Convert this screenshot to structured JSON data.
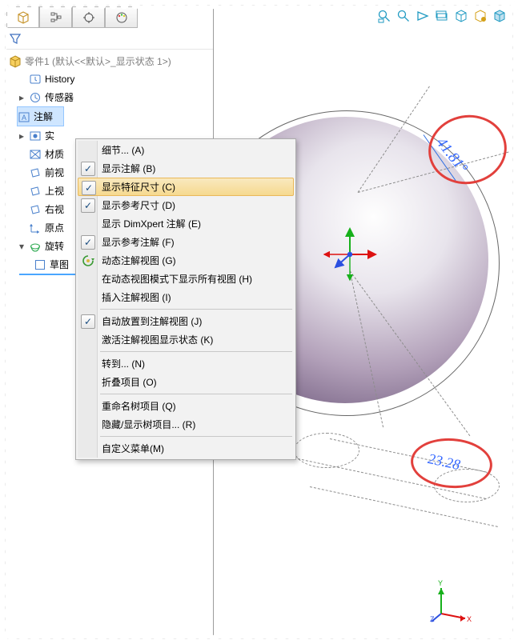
{
  "topIcons": [
    "cube",
    "tree",
    "target",
    "palette"
  ],
  "root": "零件1  (默认<<默认>_显示状态 1>)",
  "tree": [
    {
      "icon": "history",
      "label": "History",
      "expander": ""
    },
    {
      "icon": "sensor",
      "label": "传感器",
      "expander": "▸"
    },
    {
      "icon": "annot",
      "label": "注解",
      "expander": "▸",
      "selected": true
    },
    {
      "icon": "solid",
      "label": "实",
      "expander": "▸"
    },
    {
      "icon": "mat",
      "label": "材质",
      "expander": ""
    },
    {
      "icon": "plane",
      "label": "前视",
      "expander": ""
    },
    {
      "icon": "plane",
      "label": "上视",
      "expander": ""
    },
    {
      "icon": "plane",
      "label": "右视",
      "expander": ""
    },
    {
      "icon": "origin",
      "label": "原点",
      "expander": ""
    },
    {
      "icon": "rev",
      "label": "旋转",
      "expander": "▾"
    },
    {
      "icon": "sketch",
      "label": "草图",
      "expander": "",
      "sub": true
    }
  ],
  "menu": [
    {
      "type": "item",
      "label": "细节... (A)"
    },
    {
      "type": "item",
      "label": "显示注解 (B)",
      "check": true
    },
    {
      "type": "item",
      "label": "显示特征尺寸 (C)",
      "check": true,
      "hover": true
    },
    {
      "type": "item",
      "label": "显示参考尺寸 (D)",
      "check": true
    },
    {
      "type": "item",
      "label": "显示 DimXpert 注解 (E)"
    },
    {
      "type": "item",
      "label": "显示参考注解 (F)",
      "check": true
    },
    {
      "type": "item",
      "label": "动态注解视图 (G)",
      "glyph": "dyn"
    },
    {
      "type": "item",
      "label": "在动态视图模式下显示所有视图 (H)"
    },
    {
      "type": "item",
      "label": "插入注解视图 (I)"
    },
    {
      "type": "sep"
    },
    {
      "type": "item",
      "label": "自动放置到注解视图 (J)",
      "check": true
    },
    {
      "type": "item",
      "label": "激活注解视图显示状态 (K)"
    },
    {
      "type": "sep"
    },
    {
      "type": "item",
      "label": "转到... (N)"
    },
    {
      "type": "item",
      "label": "折叠项目 (O)"
    },
    {
      "type": "sep"
    },
    {
      "type": "item",
      "label": "重命名树项目 (Q)"
    },
    {
      "type": "item",
      "label": "隐藏/显示树项目... (R)"
    },
    {
      "type": "sep"
    },
    {
      "type": "item",
      "label": "自定义菜单(M)"
    }
  ],
  "dims": {
    "angle": "41.81°",
    "len": "23.28"
  },
  "triad": {
    "x": "X",
    "y": "Y",
    "z": "Z"
  },
  "viewBtns": [
    "zoom-window",
    "zoom-extents",
    "rotate",
    "section-2",
    "view-cube",
    "appearance",
    "view-cube-3"
  ]
}
